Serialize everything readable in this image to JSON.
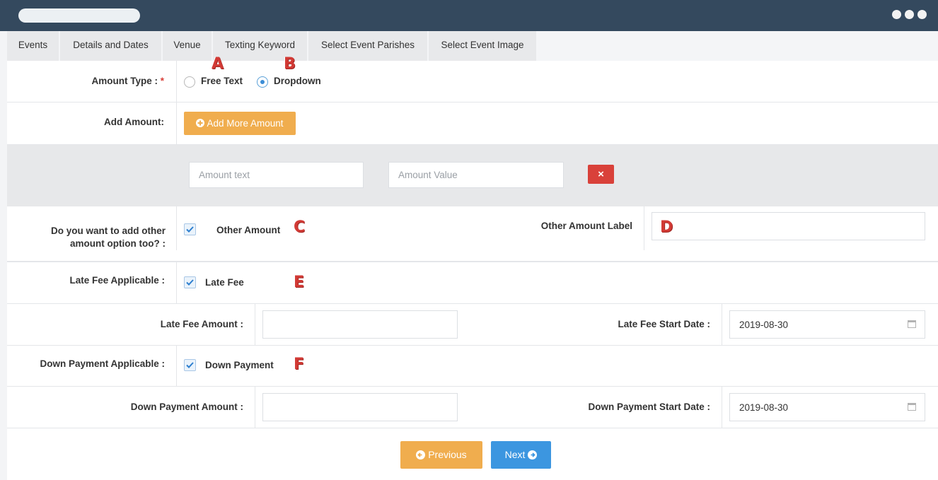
{
  "tabs": [
    "Events",
    "Details and Dates",
    "Venue",
    "Texting Keyword",
    "Select Event Parishes",
    "Select Event Image"
  ],
  "amount_type": {
    "label": "Amount Type :",
    "required_mark": "*",
    "option_free_text": "Free Text",
    "option_dropdown": "Dropdown",
    "selected": "Dropdown"
  },
  "add_amount": {
    "label": "Add Amount:",
    "button": "Add More Amount"
  },
  "amount_entry": {
    "text_placeholder": "Amount text",
    "value_placeholder": "Amount Value",
    "remove_button": "×"
  },
  "other_amount": {
    "label_line1": "Do you want to add other",
    "label_line2": "amount option too? :",
    "checkbox_label": "Other Amount",
    "checked": true,
    "field_label": "Other Amount Label",
    "field_value": ""
  },
  "late_fee": {
    "label": "Late Fee Applicable :",
    "checkbox_label": "Late Fee",
    "checked": true,
    "amount_label": "Late Fee Amount :",
    "amount_value": "",
    "start_label": "Late Fee Start Date :",
    "start_value": "2019-08-30"
  },
  "down_payment": {
    "label": "Down Payment Applicable :",
    "checkbox_label": "Down Payment",
    "checked": true,
    "amount_label": "Down Payment Amount :",
    "amount_value": "",
    "start_label": "Down Payment Start Date :",
    "start_value": "2019-08-30"
  },
  "nav": {
    "previous": "Previous",
    "next": "Next"
  },
  "markers": [
    "A",
    "B",
    "C",
    "D",
    "E",
    "F"
  ],
  "colors": {
    "titlebar": "#34495e",
    "orange_button": "#f0ad4e",
    "blue_button": "#3c96e0",
    "red_button": "#d9413a",
    "marker": "#d23a35"
  },
  "icons": {
    "window_menu": "three-dots-icon",
    "add": "plus-circle-icon",
    "previous": "arrow-left-circle-icon",
    "next": "arrow-right-circle-icon",
    "calendar": "calendar-icon",
    "check": "checkmark-icon"
  }
}
